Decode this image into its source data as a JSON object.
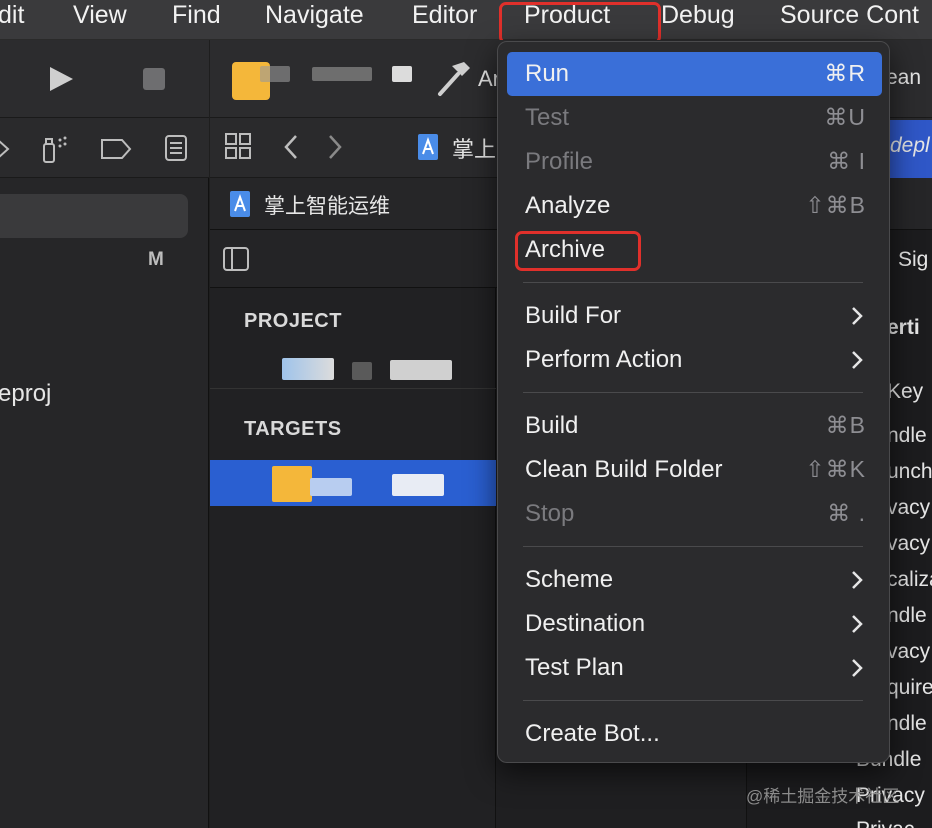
{
  "menubar": {
    "items": [
      "dit",
      "View",
      "Find",
      "Navigate",
      "Editor",
      "Product",
      "Debug",
      "Source Cont"
    ]
  },
  "navigator": {
    "status_letter": "M",
    "file_fragment": "eproj"
  },
  "editor": {
    "toolbar_fragment": "Ar",
    "clean_fragment": "ean",
    "breadcrumb": "掌上",
    "tab_title": "掌上智能运维",
    "deploy_fragment": "depl",
    "sig_fragment": "Sig",
    "section_project": "PROJECT",
    "section_targets": "TARGETS"
  },
  "right_pane": {
    "heading": "erti",
    "rows": [
      "Key",
      "ndle",
      "unch",
      "vacy",
      "vacy",
      "caliza",
      "ndle",
      "vacy",
      "quire",
      "ndle",
      "Bundle",
      "Privacy",
      "Privac"
    ]
  },
  "product_menu": {
    "items": [
      {
        "label": "Run",
        "shortcut": "⌘R",
        "state": "highlighted"
      },
      {
        "label": "Test",
        "shortcut": "⌘U",
        "state": "disabled"
      },
      {
        "label": "Profile",
        "shortcut": "⌘ I",
        "state": "disabled"
      },
      {
        "label": "Analyze",
        "shortcut": "⇧⌘B",
        "state": "enabled"
      },
      {
        "label": "Archive",
        "shortcut": "",
        "state": "enabled"
      },
      {
        "label": "Build For",
        "submenu": true
      },
      {
        "label": "Perform Action",
        "submenu": true
      },
      {
        "label": "Build",
        "shortcut": "⌘B",
        "state": "enabled"
      },
      {
        "label": "Clean Build Folder",
        "shortcut": "⇧⌘K",
        "state": "enabled"
      },
      {
        "label": "Stop",
        "shortcut": "⌘ .",
        "state": "disabled"
      },
      {
        "label": "Scheme",
        "submenu": true
      },
      {
        "label": "Destination",
        "submenu": true
      },
      {
        "label": "Test Plan",
        "submenu": true
      },
      {
        "label": "Create Bot...",
        "shortcut": "",
        "state": "enabled"
      }
    ]
  },
  "watermark": "@稀土掘金技术社区",
  "colors": {
    "menu_highlight": "#3a6fd8",
    "selection": "#2a5fd1",
    "annotation_red": "#e0302b"
  },
  "icons": [
    "run-icon",
    "stop-icon",
    "hammer-icon",
    "grid-icon",
    "back-icon",
    "forward-icon",
    "file-icon",
    "sidebar-icon",
    "chevron-right-icon",
    "tag-icon",
    "list-icon"
  ]
}
